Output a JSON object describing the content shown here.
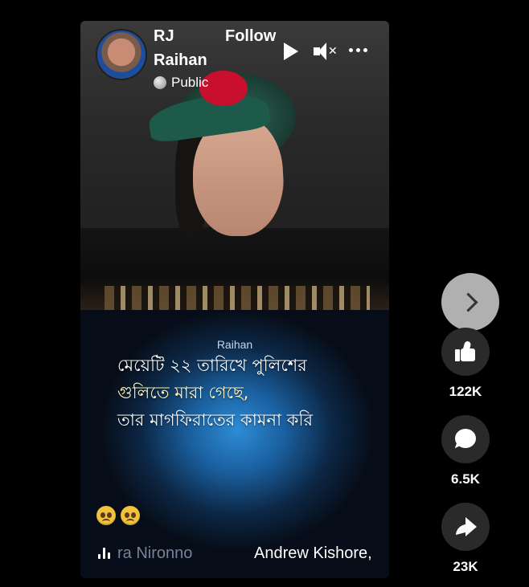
{
  "post": {
    "author_line_1": "RJ",
    "author_line_2": "Raihan",
    "follow_label": "Follow",
    "audience": "Public"
  },
  "caption": {
    "name": "Raihan",
    "line_1": "মেয়েটি ২২ তারিখে পুলিশের",
    "line_2": "গুলিতে মারা গেছে,",
    "line_3": "তার মাগফিরাতের কামনা করি"
  },
  "emojis": [
    "frowning-face",
    "frowning-face"
  ],
  "audio": {
    "text_1": "ra Nironno",
    "text_2": "Andrew Kishore,"
  },
  "actions": {
    "likes": "122K",
    "comments": "6.5K",
    "shares": "23K"
  },
  "icons": {
    "play": "play-icon",
    "mute": "muted-speaker-icon",
    "more": "more-options-icon",
    "next": "chevron-right-icon",
    "like": "thumbs-up-icon",
    "comment": "comment-bubble-icon",
    "share": "share-arrow-icon",
    "globe": "globe-icon",
    "audio": "audio-waveform-icon"
  },
  "colors": {
    "background": "#000000",
    "caption_accent": "#2e8cd6",
    "caption_highlight_line": "#fff7c6"
  }
}
